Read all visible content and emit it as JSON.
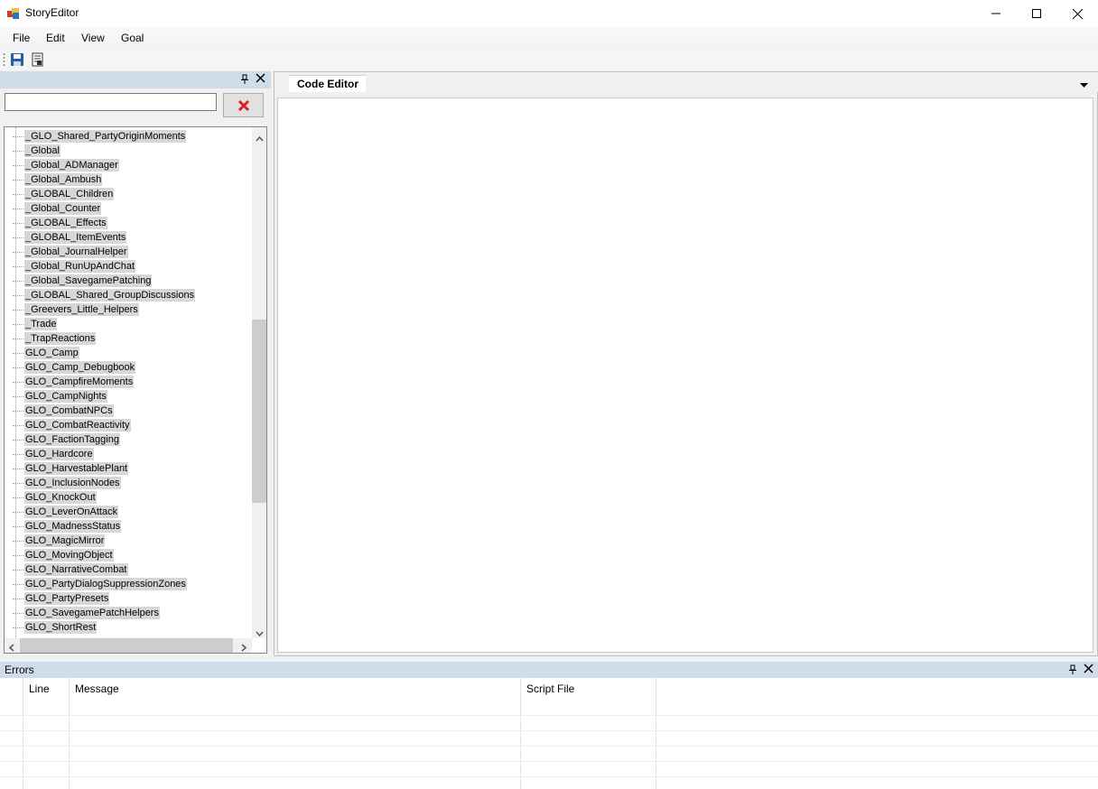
{
  "window": {
    "title": "StoryEditor"
  },
  "menu": {
    "items": [
      "File",
      "Edit",
      "View",
      "Goal"
    ]
  },
  "toolbar": {
    "buttons": [
      "save-icon",
      "script-icon"
    ]
  },
  "left_panel": {
    "search": {
      "value": "",
      "placeholder": ""
    },
    "tree_items": [
      "_GLO_Shared_PartyOriginMoments",
      "_Global",
      "_Global_ADManager",
      "_Global_Ambush",
      "_GLOBAL_Children",
      "_Global_Counter",
      "_GLOBAL_Effects",
      "_GLOBAL_ItemEvents",
      "_Global_JournalHelper",
      "_Global_RunUpAndChat",
      "_Global_SavegamePatching",
      "_GLOBAL_Shared_GroupDiscussions",
      "_Greevers_Little_Helpers",
      "_Trade",
      "_TrapReactions",
      "GLO_Camp",
      "GLO_Camp_Debugbook",
      "GLO_CampfireMoments",
      "GLO_CampNights",
      "GLO_CombatNPCs",
      "GLO_CombatReactivity",
      "GLO_FactionTagging",
      "GLO_Hardcore",
      "GLO_HarvestablePlant",
      "GLO_InclusionNodes",
      "GLO_KnockOut",
      "GLO_LeverOnAttack",
      "GLO_MadnessStatus",
      "GLO_MagicMirror",
      "GLO_MovingObject",
      "GLO_NarrativeCombat",
      "GLO_PartyDialogSuppressionZones",
      "GLO_PartyPresets",
      "GLO_SavegamePatchHelpers",
      "GLO_ShortRest"
    ]
  },
  "editor": {
    "tab_label": "Code Editor"
  },
  "errors_panel": {
    "title": "Errors",
    "columns": [
      "Line",
      "Message",
      "Script File"
    ]
  }
}
